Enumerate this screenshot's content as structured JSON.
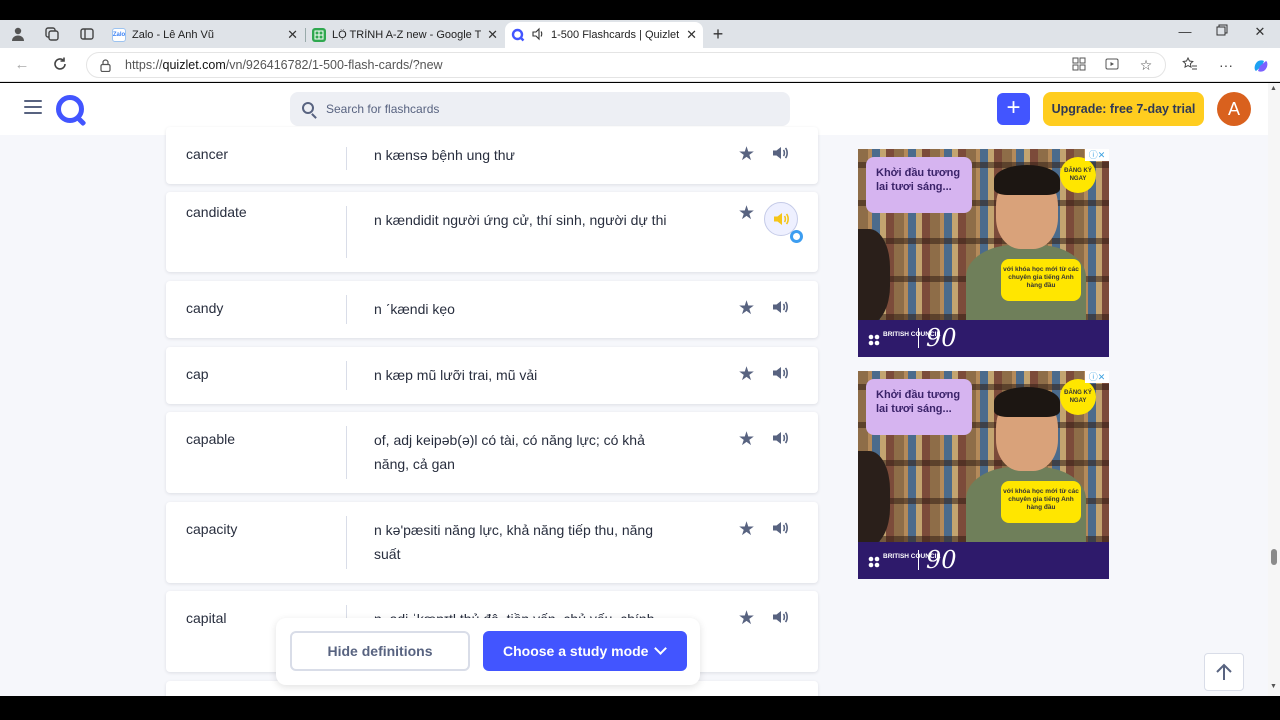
{
  "browser": {
    "tabs": [
      {
        "title": "Zalo - Lê Anh Vũ"
      },
      {
        "title": "LỘ TRÌNH A-Z new - Google Tran"
      },
      {
        "title": "1-500 Flashcards | Quizlet"
      }
    ],
    "url_prefix": "https://",
    "url_domain": "quizlet.com",
    "url_path": "/vn/926416782/1-500-flash-cards/?new"
  },
  "header": {
    "search_placeholder": "Search for flashcards",
    "upgrade_label": "Upgrade: free 7-day trial",
    "avatar_initial": "A"
  },
  "cards": [
    {
      "term": "cancer",
      "definition": "n kænsə bệnh ung thư"
    },
    {
      "term": "candidate",
      "definition": "n kændidit người ứng cử, thí sinh, người dự thi"
    },
    {
      "term": "candy",
      "definition": "n ˊkændi kẹo"
    },
    {
      "term": "cap",
      "definition": "n kæp mũ lưỡi trai, mũ vải"
    },
    {
      "term": "capable",
      "definition": "of, adj keipəb(ə)l có tài, có năng lực; có khả năng, cả gan"
    },
    {
      "term": "capacity",
      "definition": "n kə'pæsiti năng lực, khả năng tiếp thu, năng suất"
    },
    {
      "term": "capital",
      "definition": "n, adj ˈkæpɪtl thủ đô, tiền vốn, chủ yếu, chính"
    }
  ],
  "bottom_bar": {
    "hide_label": "Hide definitions",
    "study_label": "Choose a study mode"
  },
  "ads": [
    {
      "headline_1": "Khởi đầu tương",
      "headline_2": "lai tươi sáng...",
      "badge": "ĐĂNG KÝ NGAY",
      "body": "với khóa học mới từ các chuyên gia tiếng Anh hàng đầu",
      "brand": "BRITISH COUNCIL",
      "years": "90"
    },
    {
      "headline_1": "Khởi đầu tương",
      "headline_2": "lai tươi sáng...",
      "badge": "ĐĂNG KÝ NGAY",
      "body": "với khóa học mới từ các chuyên gia tiếng Anh hàng đầu",
      "brand": "BRITISH COUNCIL",
      "years": "90"
    }
  ],
  "colors": {
    "accent": "#4255ff",
    "upgrade": "#ffcd1f",
    "avatar": "#d9611e"
  }
}
